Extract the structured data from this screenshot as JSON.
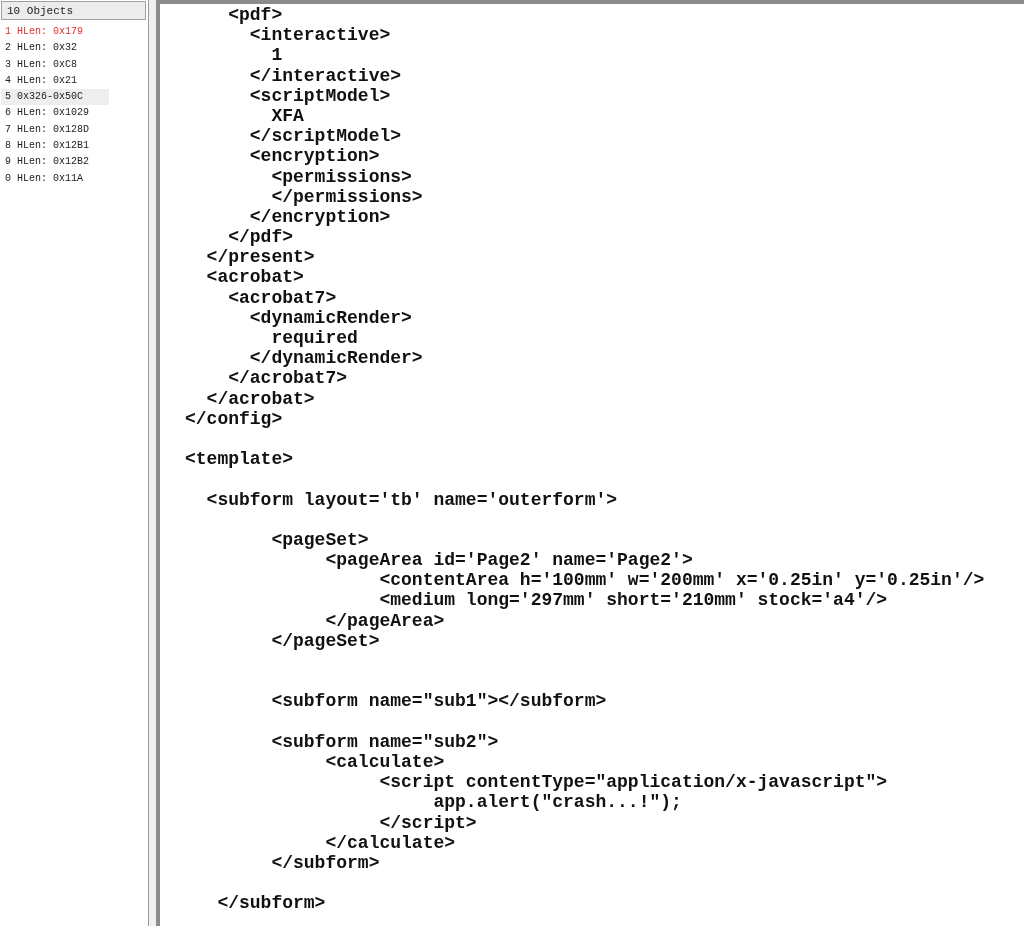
{
  "object_list": {
    "header": "10 Objects",
    "items": [
      {
        "label": "1 HLen: 0x179",
        "selected": true,
        "highlighted": false
      },
      {
        "label": "2 HLen: 0x32",
        "selected": false,
        "highlighted": false
      },
      {
        "label": "3 HLen: 0xC8",
        "selected": false,
        "highlighted": false
      },
      {
        "label": "4 HLen: 0x21",
        "selected": false,
        "highlighted": false
      },
      {
        "label": "5 0x326-0x50C",
        "selected": false,
        "highlighted": true
      },
      {
        "label": "6 HLen: 0x1029",
        "selected": false,
        "highlighted": false
      },
      {
        "label": "7 HLen: 0x128D",
        "selected": false,
        "highlighted": false
      },
      {
        "label": "8 HLen: 0x12B1",
        "selected": false,
        "highlighted": false
      },
      {
        "label": "9 HLen: 0x12B2",
        "selected": false,
        "highlighted": false
      },
      {
        "label": "0 HLen: 0x11A",
        "selected": false,
        "highlighted": false
      }
    ]
  },
  "code_view": {
    "lines": [
      {
        "kind": "code",
        "text": "    <pdf>"
      },
      {
        "kind": "code",
        "text": "      <interactive>"
      },
      {
        "kind": "code",
        "text": "        1"
      },
      {
        "kind": "code",
        "text": "      </interactive>"
      },
      {
        "kind": "code",
        "text": "      <scriptModel>"
      },
      {
        "kind": "code",
        "text": "        XFA"
      },
      {
        "kind": "code",
        "text": "      </scriptModel>"
      },
      {
        "kind": "code",
        "text": "      <encryption>"
      },
      {
        "kind": "code",
        "text": "        <permissions>"
      },
      {
        "kind": "code",
        "text": "        </permissions>"
      },
      {
        "kind": "code",
        "text": "      </encryption>"
      },
      {
        "kind": "code",
        "text": "    </pdf>"
      },
      {
        "kind": "code",
        "text": "  </present>"
      },
      {
        "kind": "code",
        "text": "  <acrobat>"
      },
      {
        "kind": "code",
        "text": "    <acrobat7>"
      },
      {
        "kind": "code",
        "text": "      <dynamicRender>"
      },
      {
        "kind": "code",
        "text": "        required"
      },
      {
        "kind": "code",
        "text": "      </dynamicRender>"
      },
      {
        "kind": "code",
        "text": "    </acrobat7>"
      },
      {
        "kind": "code",
        "text": "  </acrobat>"
      },
      {
        "kind": "code",
        "text": "</config>"
      },
      {
        "kind": "blank"
      },
      {
        "kind": "code",
        "text": "<template>"
      },
      {
        "kind": "blank"
      },
      {
        "kind": "code",
        "text": "  <subform layout='tb' name='outerform'>"
      },
      {
        "kind": "blank"
      },
      {
        "kind": "code",
        "text": "        <pageSet>"
      },
      {
        "kind": "code",
        "text": "             <pageArea id='Page2' name='Page2'>"
      },
      {
        "kind": "code",
        "text": "                  <contentArea h='100mm' w='200mm' x='0.25in' y='0.25in'/>"
      },
      {
        "kind": "code",
        "text": "                  <medium long='297mm' short='210mm' stock='a4'/>"
      },
      {
        "kind": "code",
        "text": "             </pageArea>"
      },
      {
        "kind": "code",
        "text": "        </pageSet>"
      },
      {
        "kind": "blank"
      },
      {
        "kind": "blank"
      },
      {
        "kind": "code",
        "text": "        <subform name=\"sub1\"></subform>"
      },
      {
        "kind": "blank"
      },
      {
        "kind": "code",
        "text": "        <subform name=\"sub2\">"
      },
      {
        "kind": "code",
        "text": "             <calculate>"
      },
      {
        "kind": "code",
        "text": "                  <script contentType=\"application/x-javascript\">"
      },
      {
        "kind": "code",
        "text": "                       app.alert(\"crash...!\");"
      },
      {
        "kind": "code",
        "text": "                  </script>"
      },
      {
        "kind": "code",
        "text": "             </calculate>"
      },
      {
        "kind": "code",
        "text": "        </subform>"
      },
      {
        "kind": "blank"
      },
      {
        "kind": "code",
        "text": "   </subform>"
      }
    ]
  }
}
